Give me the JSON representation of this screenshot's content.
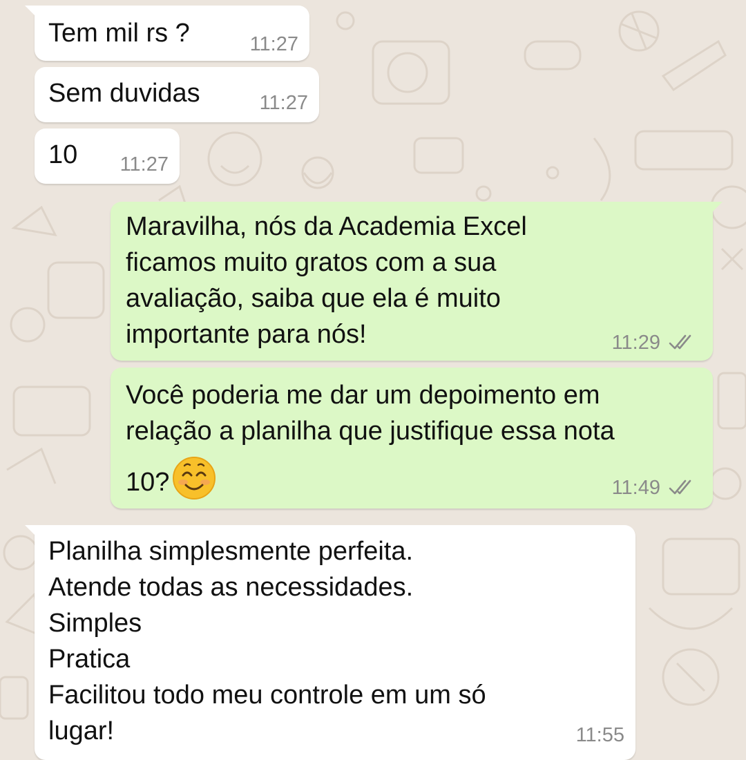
{
  "conversation": {
    "messages": [
      {
        "id": "m1",
        "direction": "incoming",
        "text": "Tem mil rs ?",
        "time": "11:27"
      },
      {
        "id": "m2",
        "direction": "incoming",
        "text": "Sem duvidas",
        "time": "11:27"
      },
      {
        "id": "m3",
        "direction": "incoming",
        "text": "10",
        "time": "11:27"
      },
      {
        "id": "m4",
        "direction": "outgoing",
        "lines": [
          "Maravilha, nós da Academia Excel",
          "ficamos muito gratos com a sua",
          "avaliação, saiba que ela é muito",
          "importante para nós!"
        ],
        "time": "11:29",
        "status": "read"
      },
      {
        "id": "m5",
        "direction": "outgoing",
        "lines": [
          "Você poderia me dar um depoimento em",
          "relação a planilha que justifique essa nota",
          "10?"
        ],
        "emoji": "smiling-face-with-smiling-eyes",
        "time": "11:49",
        "status": "read"
      },
      {
        "id": "m6",
        "direction": "incoming",
        "lines": [
          "Planilha simplesmente perfeita.",
          "Atende todas as necessidades.",
          "Simples",
          "Pratica",
          "Facilitou todo meu controle em um só",
          "lugar!"
        ],
        "time": "11:55"
      }
    ]
  },
  "theme": {
    "wallpaper_color": "#ECE5DD",
    "incoming_bubble": "#FFFFFF",
    "outgoing_bubble": "#DCF8C6",
    "timestamp_color": "#8A8A8A",
    "read_ticks_color": "#8A8A8A"
  }
}
